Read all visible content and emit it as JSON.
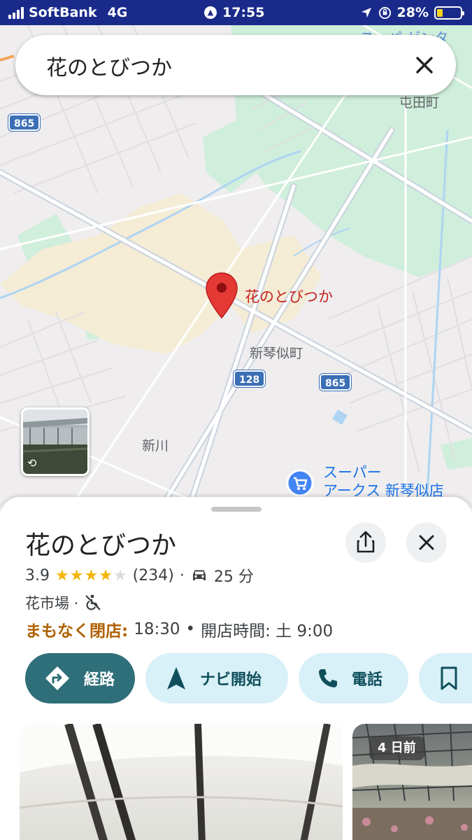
{
  "status_bar": {
    "carrier": "SoftBank",
    "network": "4G",
    "time": "17:55",
    "battery": "28%",
    "battery_level": 0.28
  },
  "search": {
    "query": "花のとびつか"
  },
  "map": {
    "place_pin_label": "花のとびつか",
    "labels": {
      "tondenchou": "屯田町",
      "shinkotonichou": "新琴似町",
      "shinkawa": "新川",
      "super_partial": "スーパ ゼンタ",
      "super_arcs_line1": "スーパー",
      "super_arcs_line2": "アークス 新琴似店"
    },
    "shields": {
      "r865_top": "865",
      "r128": "128",
      "r865_mid": "865"
    }
  },
  "place": {
    "name": "花のとびつか",
    "rating": "3.9",
    "rating_value": 3.9,
    "reviews": "(234)",
    "drive_time": "25 分",
    "category": "花市場 ·",
    "closing_status": "まもなく閉店:",
    "closing_time": "18:30",
    "hours_separator": "•",
    "opening_info": "開店時間: 土 9:00"
  },
  "actions": {
    "route": "経路",
    "navi": "ナビ開始",
    "call": "電話"
  },
  "photos": {
    "badge": "4 日前"
  },
  "colors": {
    "status_bar": "#1a2a8a",
    "primary_action": "#2f6f7a",
    "secondary_action": "#d8f0f7",
    "pin": "#d93025",
    "star": "#f4b400",
    "closing": "#b06000"
  }
}
